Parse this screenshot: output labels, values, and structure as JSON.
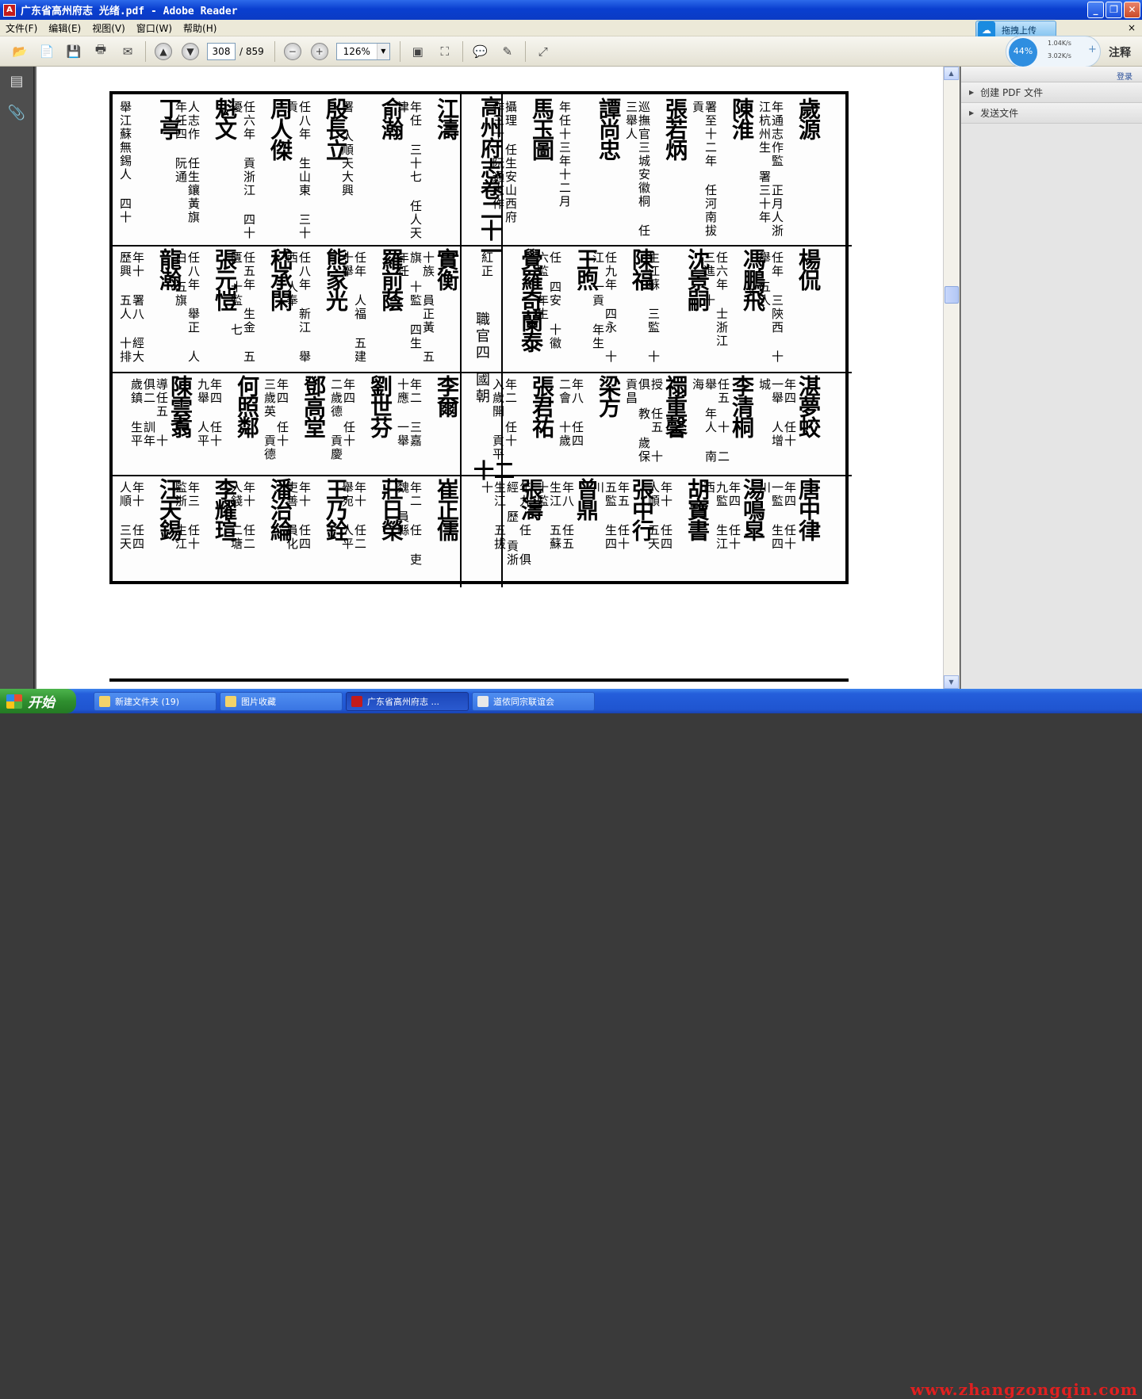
{
  "window": {
    "title": "广东省高州府志 光绪.pdf - Adobe Reader",
    "app_icon": "A"
  },
  "menu": {
    "items": [
      "文件(F)",
      "编辑(E)",
      "视图(V)",
      "窗口(W)",
      "帮助(H)"
    ],
    "close": "×"
  },
  "toolbar": {
    "page_current": "308",
    "page_total": "/ 859",
    "zoom": "126%",
    "annotate_label": "注释"
  },
  "upload_widget": {
    "label": "拖拽上传",
    "percent": "44%",
    "up_speed": "1.04K/s",
    "down_speed": "3.02K/s",
    "plus": "+"
  },
  "right_panel": {
    "login": "登录",
    "items": [
      "创建 PDF 文件",
      "发送文件"
    ]
  },
  "document": {
    "center_title": "高州府志卷二十一",
    "center_subtitle": "職官四",
    "center_subtitle2": "國朝",
    "page_number": "十二",
    "rows": [
      {
        "right": [
          {
            "name": "歲源",
            "note": "年通志作監 正月人浙江杭州生 署三十年"
          },
          {
            "name": "陳淮",
            "note": "署至十二年 任河南拔貢"
          },
          {
            "name": "張若炳",
            "note": "巡撫官三城安徽桐 任三舉人"
          },
          {
            "name": "譚尚忠",
            "note": "年任十三年十二月"
          },
          {
            "name": "馬玉圖",
            "note": "攝理 任生安山西府 作三十 阮通志作"
          }
        ],
        "left": [
          {
            "name": "江濤",
            "note": "年任 三十七 任人天津"
          },
          {
            "name": "俞瀚",
            "note": "署 人順天大興"
          },
          {
            "name": "殷長立",
            "note": "任八年 生山東 三十貢"
          },
          {
            "name": "周人傑",
            "note": "任六年 貢浙江 四十優"
          },
          {
            "name": "魁文",
            "note": "人志作 任生鑲黃旗 年任四 阮通"
          },
          {
            "name": "丁亭",
            "note": "舉江蘇無錫人 四十"
          }
        ]
      },
      {
        "right": [
          {
            "name": "楊侃",
            "note": "任年 三陝西 十舉 五人"
          },
          {
            "name": "馮鵬飛",
            "note": "任六年 士浙江 三進 十"
          },
          {
            "name": "沈景嗣",
            "note": "生江蘇 三監 十"
          },
          {
            "name": "陳福",
            "note": "任九年 四永 十江 一貢 年生"
          },
          {
            "name": "王煦",
            "note": "任 四安 十徽 六監 年生"
          },
          {
            "name": "覺羅奇蘭泰",
            "note": "紅正"
          }
        ],
        "left": [
          {
            "name": "實衡",
            "note": "十族 員正黃 五旗 十監 四生 年任"
          },
          {
            "name": "羅前蔭",
            "note": "任年 人福 五建 十舉"
          },
          {
            "name": "熊家光",
            "note": "任八年 新江 舉西 人奉"
          },
          {
            "name": "嵇承閑",
            "note": "任五年 生金 五匱 十監 七"
          },
          {
            "name": "張元愷",
            "note": "任八年 舉正 人白 五旗"
          },
          {
            "name": "龍瀚",
            "note": "年十 署八 經大 歷興 五人 十排"
          }
        ]
      },
      {
        "right": [
          {
            "name": "湛夢蛟",
            "note": "年四 任十 一舉 人增 城"
          },
          {
            "name": "李清桐",
            "note": "任五 十 二舉 年人 南 海"
          },
          {
            "name": "禤重馨",
            "note": "授 任五 十 俱 教 歲保 貢昌"
          },
          {
            "name": "梁方",
            "note": "年八 任四 二會 十歲"
          },
          {
            "name": "張君祐",
            "note": "年二 任十 入歲開 貢平"
          }
        ],
        "left": [
          {
            "name": "李爾",
            "note": "年二 三嘉 十應 一舉"
          },
          {
            "name": "劉世芬",
            "note": "年四 任十 二歲德 貢慶"
          },
          {
            "name": "鄧高堂",
            "note": "年四 任十 三歲英 貢德"
          },
          {
            "name": "何照鄰",
            "note": "年四 任十 九舉 人平"
          },
          {
            "name": "陳雲翥",
            "note": "導任五 十 俱二 訓年 歲鎮 生平"
          }
        ]
      },
      {
        "right": [
          {
            "name": "唐中律",
            "note": "年四 任十 一監 生四 川"
          },
          {
            "name": "湯鳴皐",
            "note": "年四 任十 九監 生江 西"
          },
          {
            "name": "胡寶書",
            "note": "年十 任四 人順 五天"
          },
          {
            "name": "張中行",
            "note": "年五 任十 五監 生四 川"
          },
          {
            "name": "曾鼎",
            "note": "年八 任五 生江 五蘇 十監"
          },
          {
            "name": "張濤",
            "note": "年九 任 俱 經 歷 貢浙 生江 五拔 十"
          }
        ],
        "left": [
          {
            "name": "崔正儒",
            "note": "年二 任 吏魏 員縣"
          },
          {
            "name": "莊日榮",
            "note": "年十 任二 舉宛 人平"
          },
          {
            "name": "王乃銓",
            "note": "年十 任四 吏善 員化"
          },
          {
            "name": "潘治綸",
            "note": "年十 任二 人錢 二塘"
          },
          {
            "name": "李耀瑄",
            "note": "年三 任十 監浙 生江"
          },
          {
            "name": "汪天錫",
            "note": "年十 任四 人順 三天"
          }
        ]
      }
    ]
  },
  "taskbar": {
    "start": "开始",
    "tasks": [
      "新建文件夹 (19)",
      "图片收藏",
      "广东省高州府志 ...",
      "道侬同宗联谊会"
    ],
    "watermark": "www.zhangzongqin.com"
  }
}
